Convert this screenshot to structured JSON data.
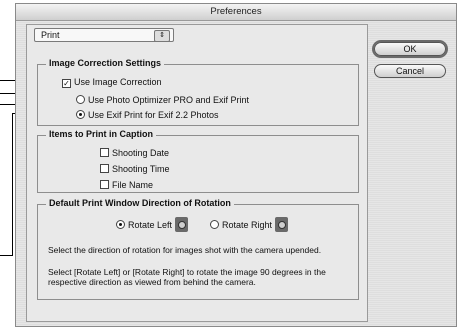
{
  "window": {
    "title": "Preferences"
  },
  "category": {
    "selected": "Print"
  },
  "buttons": {
    "ok": "OK",
    "cancel": "Cancel"
  },
  "image_correction": {
    "title": "Image Correction Settings",
    "use_correction": "Use Image Correction",
    "option_optimizer": "Use Photo Optimizer PRO and Exif Print",
    "option_exif": "Use Exif Print for Exif 2.2 Photos"
  },
  "caption": {
    "title": "Items to Print in Caption",
    "shooting_date": "Shooting Date",
    "shooting_time": "Shooting Time",
    "file_name": "File Name"
  },
  "rotation": {
    "title": "Default Print Window Direction of Rotation",
    "rotate_left": "Rotate Left",
    "rotate_right": "Rotate Right",
    "desc1": "Select the direction of rotation for images shot with the camera upended.",
    "desc2": "Select [Rotate Left] or [Rotate Right] to rotate the image 90 degrees in the respective direction as viewed from behind the camera."
  },
  "state": {
    "use_correction_checked": true,
    "selected_correction": "exif",
    "shooting_date_checked": false,
    "shooting_time_checked": false,
    "file_name_checked": false,
    "selected_rotation": "left"
  }
}
